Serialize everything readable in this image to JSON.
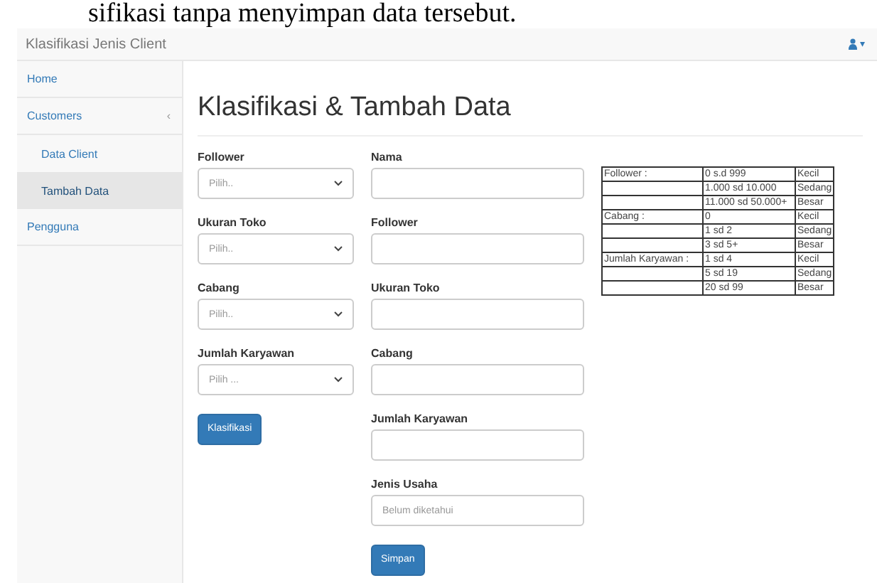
{
  "caption": "sifikasi tanpa menyimpan data tersebut.",
  "navbar": {
    "brand": "Klasifikasi Jenis Client",
    "user_menu": "▾"
  },
  "sidebar": {
    "items": [
      {
        "label": "Home",
        "selected": false,
        "sub": false
      },
      {
        "label": "Customers",
        "selected": false,
        "sub": false,
        "caret": "‹"
      },
      {
        "label": "Data Client",
        "selected": false,
        "sub": true
      },
      {
        "label": "Tambah Data",
        "selected": true,
        "sub": true
      },
      {
        "label": "Pengguna",
        "selected": false,
        "sub": false
      }
    ]
  },
  "page_title": "Klasifikasi & Tambah Data",
  "classify_form": {
    "fields": [
      {
        "label": "Follower",
        "placeholder": "Pilih.."
      },
      {
        "label": "Ukuran Toko",
        "placeholder": "Pilih.."
      },
      {
        "label": "Cabang",
        "placeholder": "Pilih.."
      },
      {
        "label": "Jumlah Karyawan",
        "placeholder": "Pilih ..."
      }
    ],
    "button": "Klasifikasi"
  },
  "data_form": {
    "fields": [
      {
        "label": "Nama"
      },
      {
        "label": "Follower"
      },
      {
        "label": "Ukuran Toko"
      },
      {
        "label": "Cabang"
      },
      {
        "label": "Jumlah Karyawan"
      },
      {
        "label": "Jenis Usaha",
        "placeholder": "Belum diketahui"
      }
    ],
    "button": "Simpan"
  },
  "reference_table": {
    "rows": [
      [
        "Follower :",
        "0 s.d 999",
        "Kecil"
      ],
      [
        "",
        "1.000 sd 10.000",
        "Sedang"
      ],
      [
        "",
        "11.000 sd 50.000+",
        "Besar"
      ],
      [
        "Cabang :",
        "0",
        "Kecil"
      ],
      [
        "",
        "1 sd 2",
        "Sedang"
      ],
      [
        "",
        "3 sd 5+",
        "Besar"
      ],
      [
        "Jumlah Karyawan :",
        "1 sd 4",
        "Kecil"
      ],
      [
        "",
        "5 sd 19",
        "Sedang"
      ],
      [
        "",
        "20 sd 99",
        "Besar"
      ]
    ]
  }
}
